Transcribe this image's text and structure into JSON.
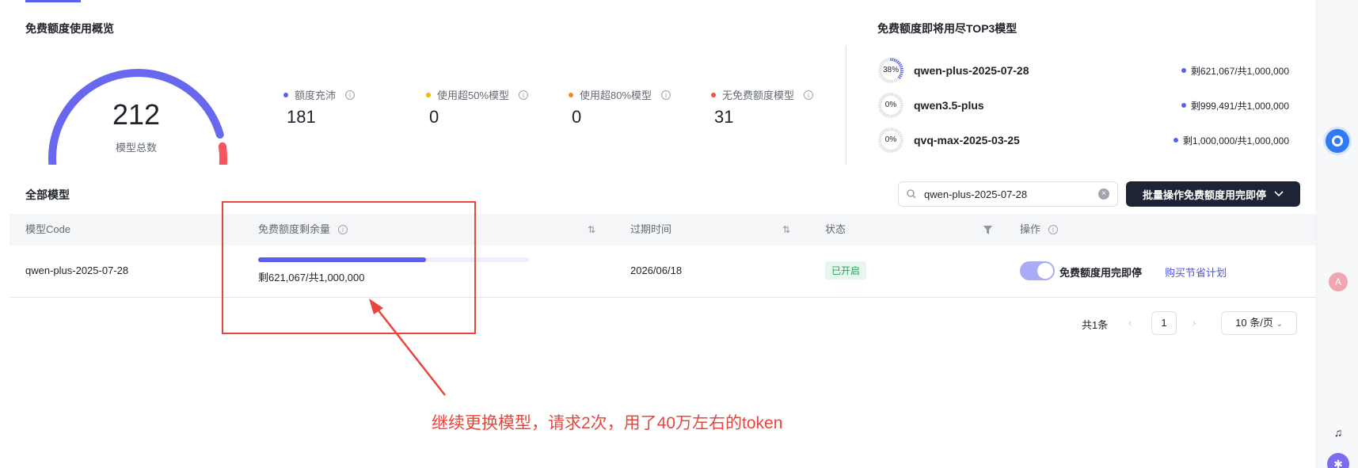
{
  "overview": {
    "title": "免费额度使用概览",
    "total_models": "212",
    "total_label": "模型总数",
    "stats": [
      {
        "label": "额度充沛",
        "value": "181",
        "color": "#5b5fef"
      },
      {
        "label": "使用超50%模型",
        "value": "0",
        "color": "#f5b800"
      },
      {
        "label": "使用超80%模型",
        "value": "0",
        "color": "#f08a24"
      },
      {
        "label": "无免费额度模型",
        "value": "31",
        "color": "#f54a45"
      }
    ],
    "gauge": {
      "ok_fraction": 0.854,
      "empty_fraction": 0.146,
      "ok_color": "#6768ee",
      "empty_color": "#f4555f"
    }
  },
  "top3": {
    "title": "免费额度即将用尽TOP3模型",
    "items": [
      {
        "percent": "38%",
        "used_fraction": 0.38,
        "name": "qwen-plus-2025-07-28",
        "remain": "剩621,067/共1,000,000"
      },
      {
        "percent": "0%",
        "used_fraction": 0,
        "name": "qwen3.5-plus",
        "remain": "剩999,491/共1,000,000"
      },
      {
        "percent": "0%",
        "used_fraction": 0,
        "name": "qvq-max-2025-03-25",
        "remain": "剩1,000,000/共1,000,000"
      }
    ]
  },
  "models": {
    "title": "全部模型",
    "search_value": "qwen-plus-2025-07-28",
    "batch_button": "批量操作免费额度用完即停",
    "columns": {
      "code": "模型Code",
      "remaining": "免费额度剩余量",
      "expire": "过期时间",
      "status": "状态",
      "action": "操作"
    },
    "rows": [
      {
        "code": "qwen-plus-2025-07-28",
        "remain_fraction": 0.621,
        "remain_text": "剩621,067/共1,000,000",
        "expire": "2026/06/18",
        "status": "已开启",
        "toggle_label": "免费额度用完即停",
        "buy_link": "购买节省计划"
      }
    ],
    "pagination": {
      "total": "共1条",
      "current": "1",
      "page_size": "10 条/页"
    }
  },
  "annotation": {
    "text": "继续更换模型，请求2次，用了40万左右的token",
    "color": "#e8453c"
  }
}
